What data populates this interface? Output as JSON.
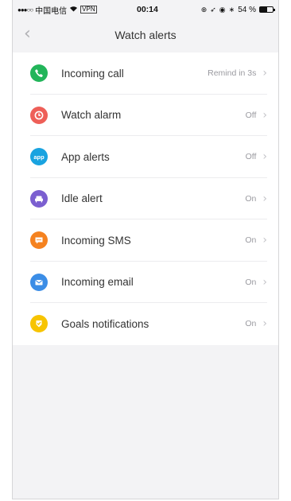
{
  "statusbar": {
    "carrier": "中国电信",
    "network": "VPN",
    "time": "00:14",
    "battery": "54 %",
    "battery_level": 0.54
  },
  "header": {
    "title": "Watch alerts",
    "back_icon": "chevron-left-icon"
  },
  "alerts": [
    {
      "label": "Incoming call",
      "value": "Remind in 3s",
      "color": "#22b55a",
      "icon": "phone-icon"
    },
    {
      "label": "Watch alarm",
      "value": "Off",
      "color": "#ee5f58",
      "icon": "clock-icon"
    },
    {
      "label": "App alerts",
      "value": "Off",
      "color": "#19a3e0",
      "icon": "app-icon"
    },
    {
      "label": "Idle alert",
      "value": "On",
      "color": "#7b5fd0",
      "icon": "sofa-icon"
    },
    {
      "label": "Incoming SMS",
      "value": "On",
      "color": "#f5821f",
      "icon": "message-icon"
    },
    {
      "label": "Incoming email",
      "value": "On",
      "color": "#3b8de6",
      "icon": "envelope-icon"
    },
    {
      "label": "Goals notifications",
      "value": "On",
      "color": "#f7c400",
      "icon": "goal-icon"
    }
  ]
}
